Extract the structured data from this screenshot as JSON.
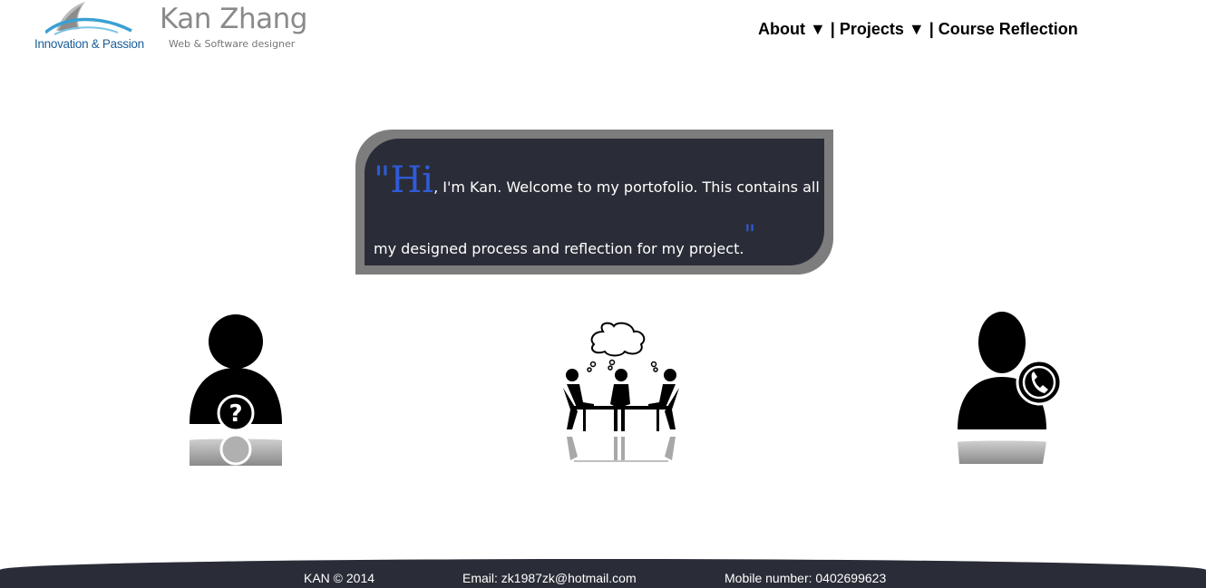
{
  "logo": {
    "tagline": "Innovation & Passion",
    "icon": "wave-fin-logo"
  },
  "brand": {
    "name": "Kan Zhang",
    "subtitle": "Web & Software designer"
  },
  "nav": {
    "items": [
      {
        "label": "About ▼"
      },
      {
        "label": "Projects ▼"
      },
      {
        "label": "Course Reflection"
      }
    ],
    "separator": " | "
  },
  "welcome": {
    "hi": "\"Hi",
    "text": ", I'm Kan. Welcome to my portofolio. This contains all my designed process and reflection for my project.",
    "close_quote": "\"",
    "accent_color": "#2f5bd8",
    "box_color": "#2a2d37"
  },
  "features": [
    {
      "icon": "user-question-icon"
    },
    {
      "icon": "team-meeting-icon"
    },
    {
      "icon": "user-phone-icon"
    }
  ],
  "footer": {
    "copyright": "KAN © 2014",
    "email": "Email: zk1987zk@hotmail.com",
    "mobile": "Mobile number: 0402699623"
  }
}
